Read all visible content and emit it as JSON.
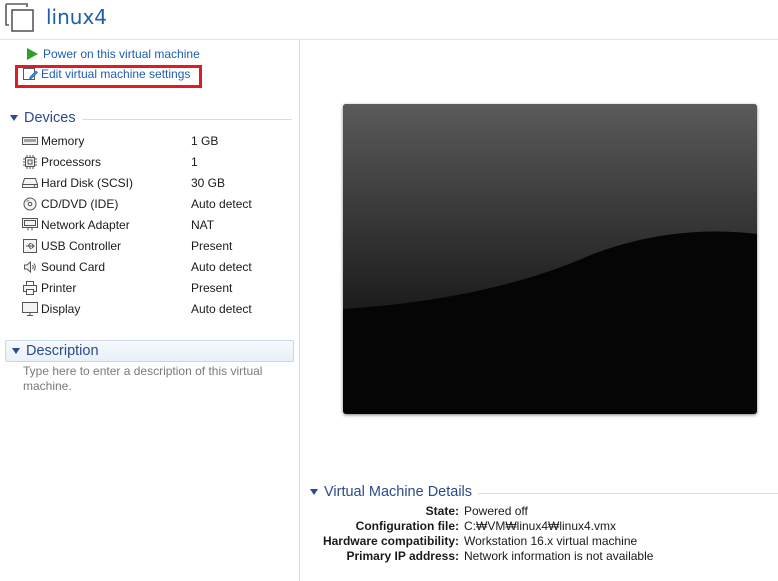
{
  "vm": {
    "title": "linux4"
  },
  "commands": {
    "power_on": "Power on this virtual machine",
    "edit_settings": "Edit virtual machine settings"
  },
  "devices": {
    "header": "Devices",
    "items": [
      {
        "name": "Memory",
        "value": "1 GB",
        "icon": "memory-icon"
      },
      {
        "name": "Processors",
        "value": "1",
        "icon": "processor-icon"
      },
      {
        "name": "Hard Disk (SCSI)",
        "value": "30 GB",
        "icon": "hard-disk-icon"
      },
      {
        "name": "CD/DVD (IDE)",
        "value": "Auto detect",
        "icon": "cd-dvd-icon"
      },
      {
        "name": "Network Adapter",
        "value": "NAT",
        "icon": "network-adapter-icon"
      },
      {
        "name": "USB Controller",
        "value": "Present",
        "icon": "usb-icon"
      },
      {
        "name": "Sound Card",
        "value": "Auto detect",
        "icon": "speaker-icon"
      },
      {
        "name": "Printer",
        "value": "Present",
        "icon": "printer-icon"
      },
      {
        "name": "Display",
        "value": "Auto detect",
        "icon": "display-icon"
      }
    ]
  },
  "description": {
    "header": "Description",
    "placeholder": "Type here to enter a description of this virtual machine."
  },
  "details": {
    "header": "Virtual Machine Details",
    "rows": [
      {
        "label": "State:",
        "value": "Powered off"
      },
      {
        "label": "Configuration file:",
        "value": "C:₩VM₩linux4₩linux4.vmx"
      },
      {
        "label": "Hardware compatibility:",
        "value": "Workstation 16.x virtual machine"
      },
      {
        "label": "Primary IP address:",
        "value": "Network information is not available"
      }
    ]
  },
  "colors": {
    "link": "#1d5fae",
    "section_header": "#2a4b8d",
    "highlight": "#e21b23",
    "play_green": "#2aa22a"
  }
}
